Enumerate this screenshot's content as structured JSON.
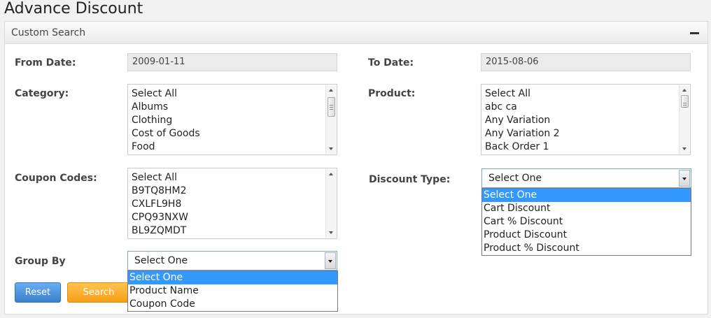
{
  "page": {
    "title": "Advance Discount"
  },
  "panel": {
    "title": "Custom Search",
    "collapse_icon": "minus-icon"
  },
  "form": {
    "from_date": {
      "label": "From Date:",
      "value": "2009-01-11"
    },
    "to_date": {
      "label": "To Date:",
      "value": "2015-08-06"
    },
    "category": {
      "label": "Category:",
      "options": [
        "Select All",
        "Albums",
        "Clothing",
        "Cost of Goods",
        "Food"
      ]
    },
    "product": {
      "label": "Product:",
      "options": [
        "Select All",
        "abc ca",
        "Any Variation",
        "Any Variation 2",
        "Back Order 1"
      ]
    },
    "coupon_codes": {
      "label": "Coupon Codes:",
      "options": [
        "Select All",
        "B9TQ8HM2",
        "CXLFL9H8",
        "CPQ93NXW",
        "BL9ZQMDT"
      ]
    },
    "discount_type": {
      "label": "Discount Type:",
      "selected": "Select One",
      "options": [
        "Select One",
        "Cart Discount",
        "Cart % Discount",
        "Product Discount",
        "Product % Discount"
      ]
    },
    "group_by": {
      "label": "Group By",
      "selected": "Select One",
      "options": [
        "Select One",
        "Product Name",
        "Coupon Code"
      ]
    }
  },
  "buttons": {
    "reset": "Reset",
    "search": "Search"
  },
  "colors": {
    "reset": "#4a90d9",
    "search": "#f9a825",
    "highlight": "#3399ff"
  }
}
